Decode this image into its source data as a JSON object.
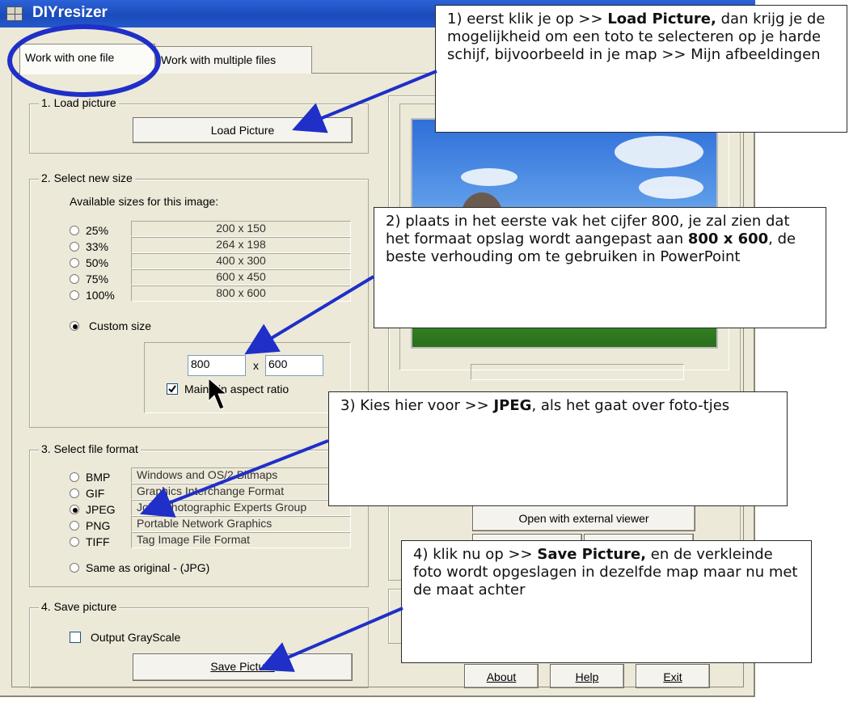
{
  "window": {
    "title": "DIYresizer"
  },
  "tabs": [
    {
      "label": "Work with one file"
    },
    {
      "label": "Work with multiple files"
    }
  ],
  "section1": {
    "label": "1. Load picture",
    "button": "Load Picture"
  },
  "section2": {
    "label": "2. Select new size",
    "available_label": "Available sizes for this image:",
    "sizes": [
      {
        "pct": "25%",
        "dims": "200 x 150"
      },
      {
        "pct": "33%",
        "dims": "264 x 198"
      },
      {
        "pct": "50%",
        "dims": "400 x 300"
      },
      {
        "pct": "75%",
        "dims": "600 x 450"
      },
      {
        "pct": "100%",
        "dims": "800 x 600"
      }
    ],
    "custom_label": "Custom size",
    "width_value": "800",
    "x_sep": "x",
    "height_value": "600",
    "aspect_label": "Maintain aspect ratio"
  },
  "section3": {
    "label": "3. Select file format",
    "formats": [
      {
        "code": "BMP",
        "desc": "Windows and OS/2 Bitmaps"
      },
      {
        "code": "GIF",
        "desc": "Graphics Interchange Format"
      },
      {
        "code": "JPEG",
        "desc": "Joint Photographic Experts Group"
      },
      {
        "code": "PNG",
        "desc": "Portable Network Graphics"
      },
      {
        "code": "TIFF",
        "desc": "Tag Image File Format"
      }
    ],
    "same_label": "Same as original  - (JPG)"
  },
  "section4": {
    "label": "4. Save picture",
    "grayscale_label": "Output GrayScale",
    "button": "Save Picture"
  },
  "right": {
    "open_external": "Open with external viewer",
    "about": "About",
    "help": "Help",
    "exit": "Exit"
  },
  "callouts": {
    "c1": {
      "pre": "1) eerst klik je op >> ",
      "bold": "Load Picture,",
      "post": " dan krijg je de mogelijkheid om een toto te selecteren op je harde schijf, bijvoorbeeld in je map >> Mijn afbeeldingen"
    },
    "c2": {
      "pre": "2) plaats in het eerste vak het cijfer 800, je zal zien dat het formaat opslag wordt aangepast aan ",
      "bold": "800 x 600",
      "post": ", de beste verhouding om te gebruiken in PowerPoint"
    },
    "c3": {
      "pre": "3) Kies hier voor >> ",
      "bold": "JPEG",
      "post": ", als het gaat over foto-tjes"
    },
    "c4": {
      "pre": "4) klik nu op >> ",
      "bold": "Save Picture,",
      "post": " en de verkleinde foto wordt opgeslagen in dezelfde map maar nu met de maat achter"
    }
  },
  "colors": {
    "annotation_blue": "#1f2fc8",
    "titlebar": "#1a4bbb"
  }
}
